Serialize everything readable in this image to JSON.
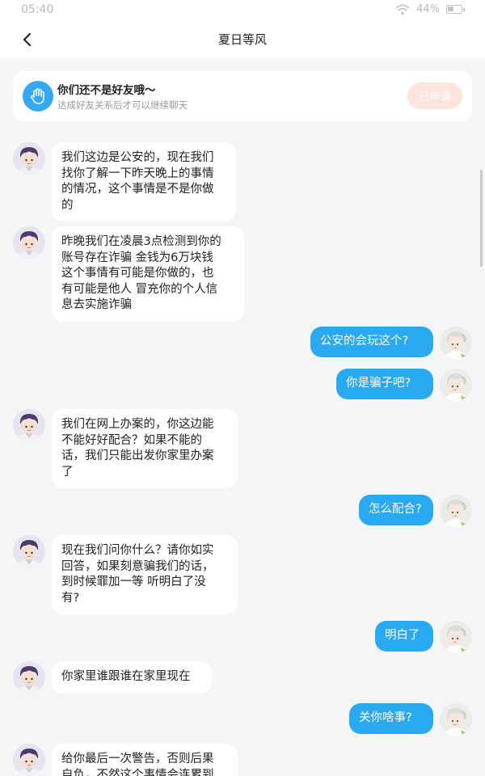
{
  "status": {
    "time": "05:40",
    "battery": "44%",
    "battery_level": 0.44
  },
  "nav": {
    "title": "夏日等风"
  },
  "friend_notice": {
    "title": "你们还不是好友哦～",
    "subtitle": "达成好友关系后才可以继续聊天",
    "button": "已申请"
  },
  "messages": [
    {
      "side": "in",
      "lines": [
        "我们这边是公安的，现在我们",
        "找你了解一下昨天晚上的事情",
        "的情况，这个事情是不是你做",
        "的"
      ]
    },
    {
      "side": "in",
      "lines": [
        "昨晚我们在凌晨3点检测到你的",
        "账号存在诈骗 金钱为6万块钱",
        "这个事情有可能是你做的，也",
        "有可能是他人 冒充你的个人信",
        "息去实施诈骗"
      ]
    },
    {
      "side": "out",
      "lines": [
        "公安的会玩这个?"
      ]
    },
    {
      "side": "out",
      "lines": [
        "你是骗子吧?"
      ]
    },
    {
      "side": "in",
      "lines": [
        "我们在网上办案的，你这边能",
        "不能好好配合？如果不能的",
        "话，我们只能出发你家里办案",
        "了"
      ]
    },
    {
      "side": "out",
      "lines": [
        "怎么配合?"
      ]
    },
    {
      "side": "in",
      "lines": [
        "现在我们问你什么？请你如实",
        "回答，如果刻意骗我们的话，",
        "到时候罪加一等 听明白了没",
        "有?"
      ]
    },
    {
      "side": "out",
      "lines": [
        "明白了"
      ]
    },
    {
      "side": "in",
      "lines": [
        "你家里谁跟谁在家里现在"
      ]
    },
    {
      "side": "out",
      "lines": [
        "关你啥事?"
      ]
    },
    {
      "side": "in",
      "lines": [
        "给你最后一次警告，否则后果",
        "自负，不然这个事情会连累到"
      ]
    }
  ]
}
